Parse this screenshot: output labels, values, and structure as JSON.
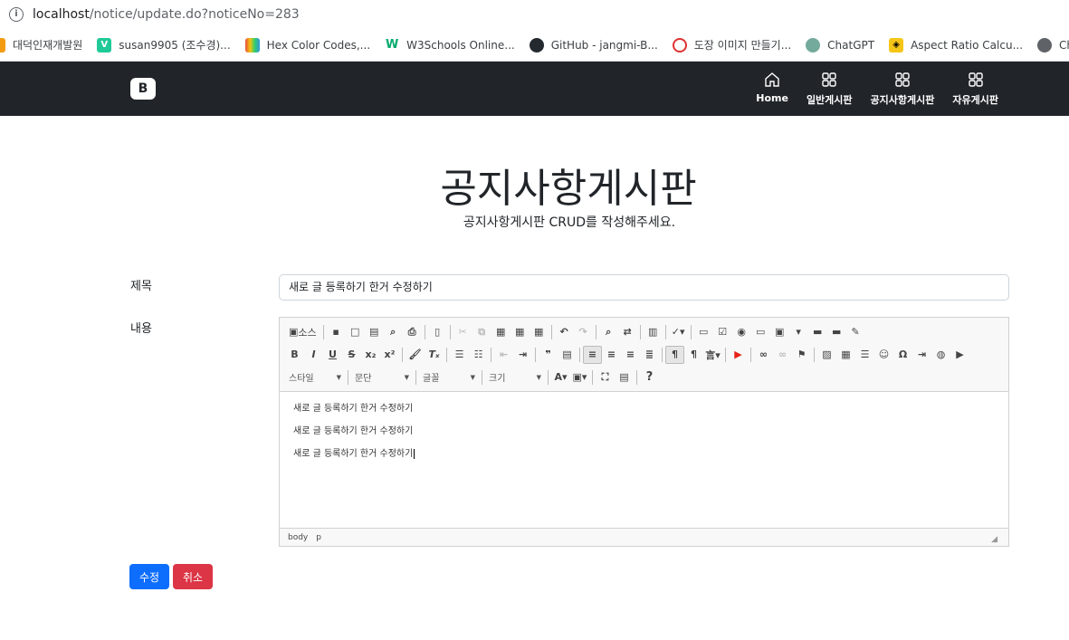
{
  "browser": {
    "url_host": "localhost",
    "url_path": "/notice/update.do?noticeNo=283",
    "bookmarks": [
      {
        "label": "대덕인재개발원",
        "color": "#f39c12"
      },
      {
        "label": "susan9905 (조수경)...",
        "color": "#20c997"
      },
      {
        "label": "Hex Color Codes,...",
        "color": "#e74c3c"
      },
      {
        "label": "W3Schools Online...",
        "color": "#04aa6d"
      },
      {
        "label": "GitHub - jangmi-B...",
        "color": "#24292f"
      },
      {
        "label": "도장 이미지 만들기...",
        "color": "#e03131"
      },
      {
        "label": "ChatGPT",
        "color": "#74aa9c"
      },
      {
        "label": "Aspect Ratio Calcu...",
        "color": "#f5c518"
      },
      {
        "label": "Chat Roo",
        "color": "#5f6368"
      }
    ]
  },
  "navbar": {
    "brand": "B",
    "items": [
      {
        "label": "Home",
        "icon": "home-icon"
      },
      {
        "label": "일반게시판",
        "icon": "grid-icon"
      },
      {
        "label": "공지사항게시판",
        "icon": "grid-icon"
      },
      {
        "label": "자유게시판",
        "icon": "grid-icon"
      }
    ]
  },
  "header": {
    "title": "공지사항게시판",
    "subtitle": "공지사항게시판 CRUD를 작성해주세요."
  },
  "form": {
    "title_label": "제목",
    "title_value": "새로 글 등록하기 한거 수정하기",
    "content_label": "내용",
    "editor": {
      "source_label": "소스",
      "style_combo": "스타일",
      "format_combo": "문단",
      "font_combo": "글꼴",
      "size_combo": "크기",
      "paragraphs": [
        "새로 글 등록하기 한거 수정하기",
        "새로 글 등록하기 한거 수정하기",
        "새로 글 등록하기 한거 수정하기"
      ],
      "path": [
        "body",
        "p"
      ]
    },
    "submit_label": "수정",
    "cancel_label": "취소"
  }
}
